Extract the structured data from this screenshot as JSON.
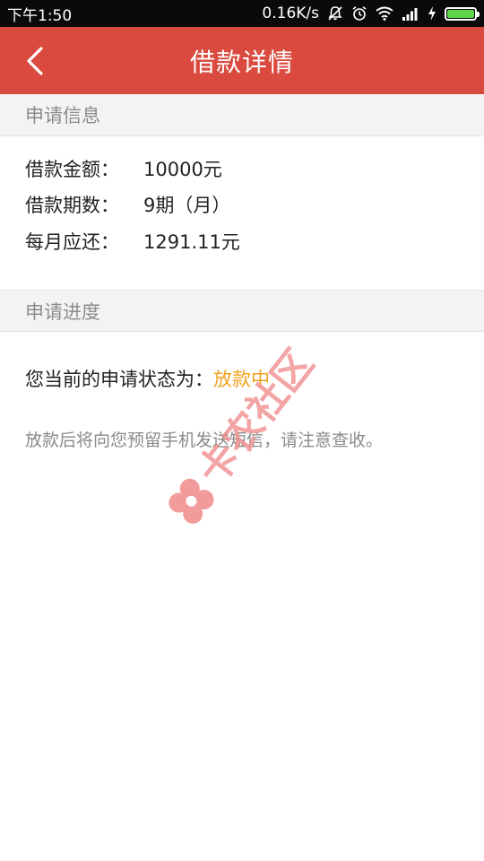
{
  "statusbar": {
    "time": "下午1:50",
    "net_speed": "0.16K/s",
    "battery_level": 1.0,
    "icons": [
      "mute-icon",
      "alarm-icon",
      "wifi-icon",
      "signal-icon",
      "charging-icon",
      "battery-icon"
    ]
  },
  "header": {
    "title": "借款详情",
    "back_icon": "chevron-left-icon",
    "background": "#da4a3e"
  },
  "application_info": {
    "section_title": "申请信息",
    "rows": [
      {
        "label": "借款金额：",
        "value": "10000元"
      },
      {
        "label": "借款期数：",
        "value": "9期（月）"
      },
      {
        "label": "每月应还：",
        "value": "1291.11元"
      }
    ]
  },
  "progress": {
    "section_title": "申请进度",
    "status_label": "您当前的申请状态为：",
    "status_value": "放款中",
    "status_color": "#f0a21d",
    "note": "放款后将向您预留手机发送短信，请注意查收。"
  },
  "watermark": {
    "text": "卡农社区",
    "color": "#f08a8a"
  }
}
